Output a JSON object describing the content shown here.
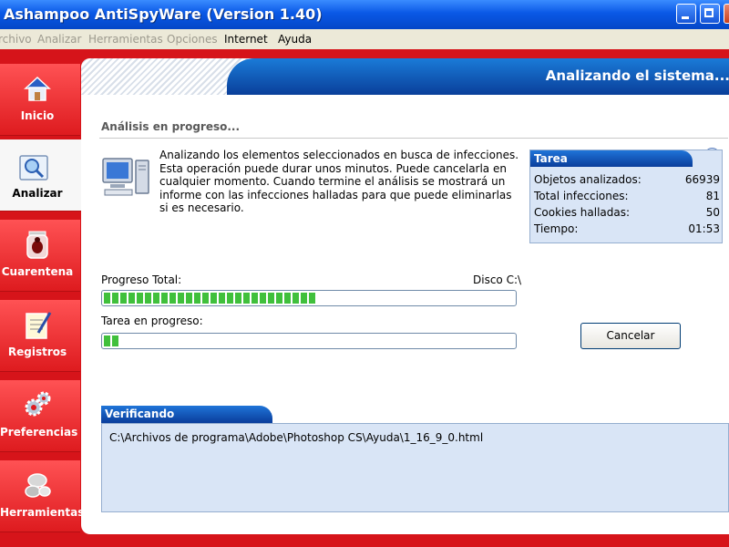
{
  "window": {
    "title": "Ashampoo AntiSpyWare (Version 1.40)"
  },
  "menu": {
    "items": [
      "rchivo",
      "Analizar",
      "Herramientas",
      "Opciones",
      "Internet",
      "Ayuda"
    ]
  },
  "sidebar": {
    "items": [
      {
        "label": "Inicio",
        "icon": "home-icon"
      },
      {
        "label": "Analizar",
        "icon": "magnifier-icon"
      },
      {
        "label": "Cuarentena",
        "icon": "bug-jar-icon"
      },
      {
        "label": "Registros",
        "icon": "notepad-icon"
      },
      {
        "label": "Preferencias",
        "icon": "gears-icon"
      },
      {
        "label": "Herramientas",
        "icon": "tools-icon"
      }
    ]
  },
  "banner": {
    "title": "Analizando el sistema..."
  },
  "section": {
    "title": "Análisis en progreso..."
  },
  "description": "Analizando los elementos seleccionados en busca de infecciones. Esta operación puede durar unos minutos. Puede cancelarla en cualquier momento. Cuando termine el análisis se mostrará un informe con las infecciones halladas para que puede eliminarlas si es necesario.",
  "tarea": {
    "title": "Tarea",
    "rows": [
      {
        "label": "Objetos analizados:",
        "value": "66939"
      },
      {
        "label": "Total infecciones:",
        "value": "81"
      },
      {
        "label": "Cookies halladas:",
        "value": "50"
      },
      {
        "label": "Tiempo:",
        "value": "01:53"
      }
    ]
  },
  "progress": {
    "total_label": "Progreso Total:",
    "disk_label": "Disco C:\\",
    "total_fraction": 0.52,
    "task_label": "Tarea en progreso:",
    "task_fraction": 0.04
  },
  "cancel_button": "Cancelar",
  "verificando": {
    "title": "Verificando",
    "path": "C:\\Archivos de programa\\Adobe\\Photoshop CS\\Ayuda\\1_16_9_0.html"
  }
}
